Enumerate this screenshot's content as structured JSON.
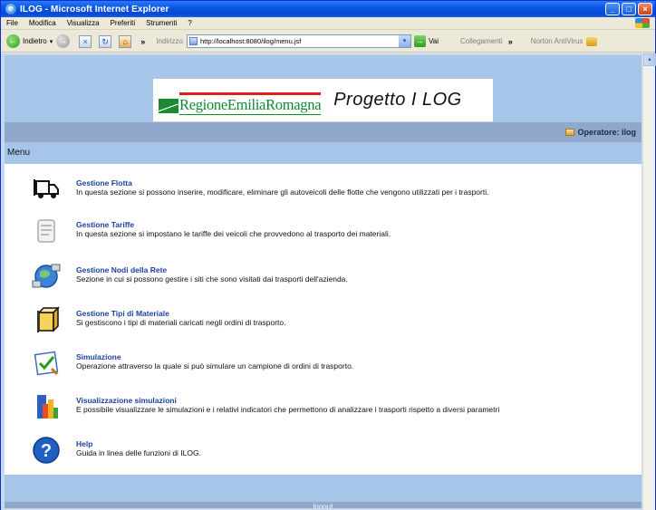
{
  "window": {
    "title": "ILOG - Microsoft Internet Explorer"
  },
  "menubar": [
    "File",
    "Modifica",
    "Visualizza",
    "Preferiti",
    "Strumenti",
    "?"
  ],
  "toolbar": {
    "back_label": "Indietro",
    "address_label": "Indirizzo",
    "address_value": "http://localhost:8080/ilog/menu.jsf",
    "go_label": "Vai",
    "links_label": "Collegamenti",
    "norton_label": "Norton AntiVirus"
  },
  "page": {
    "logo_text": "RegioneEmiliaRomagna",
    "title": "Progetto I LOG",
    "operator": "Operatore: ilog",
    "menu_label": "Menu",
    "items": [
      {
        "title": "Gestione Flotta",
        "desc": "In questa sezione si possono inserire, modificare, eliminare gli autoveicoli delle flotte che vengono utilizzati per i trasporti.",
        "icon": "truck-icon"
      },
      {
        "title": "Gestione Tariffe",
        "desc": "In questa sezione si impostano le tariffe dei veicoli che provvedono al trasporto dei materiali.",
        "icon": "price-tag-icon"
      },
      {
        "title": "Gestione Nodi della Rete",
        "desc": "Sezione in cui si possono gestire i siti che sono visitati dai trasporti dell'azienda.",
        "icon": "network-globe-icon"
      },
      {
        "title": "Gestione Tipi di Materiale",
        "desc": "Si gestiscono i tipi di materiali caricati negli ordini di trasporto.",
        "icon": "box-icon"
      },
      {
        "title": "Simulazione",
        "desc": "Operazione attraverso la quale si può simulare un campione di ordini di trasporto.",
        "icon": "checklist-icon"
      },
      {
        "title": "Visualizzazione simulazioni",
        "desc": "E possibile visualizzare le simulazioni e i relativi indicatori che permettono di analizzare i trasporti rispetto a diversi parametri",
        "icon": "bar-chart-icon"
      },
      {
        "title": "Help",
        "desc": "Guida in linea delle funzioni di ILOG.",
        "icon": "help-icon"
      }
    ],
    "logout_label": "logout"
  }
}
